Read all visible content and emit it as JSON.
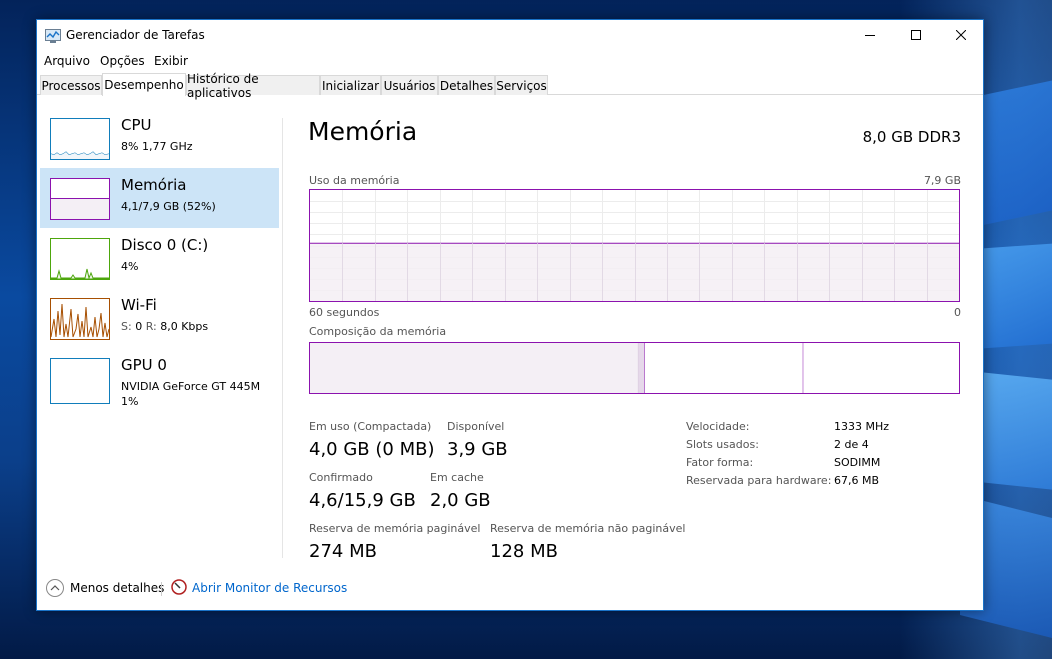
{
  "window": {
    "title": "Gerenciador de Tarefas"
  },
  "menu": [
    "Arquivo",
    "Opções",
    "Exibir"
  ],
  "tabs": [
    "Processos",
    "Desempenho",
    "Histórico de aplicativos",
    "Inicializar",
    "Usuários",
    "Detalhes",
    "Serviços"
  ],
  "active_tab": "Desempenho",
  "sidebar": {
    "items": [
      {
        "title": "CPU",
        "sub1": "8%  1,77 GHz",
        "sub2": "",
        "color": "#117dbb"
      },
      {
        "title": "Memória",
        "sub1": "4,1/7,9 GB (52%)",
        "sub2": "",
        "color": "#8b12ae"
      },
      {
        "title": "Disco 0 (C:)",
        "sub1": "4%",
        "sub2": "",
        "color": "#4da60c"
      },
      {
        "title": "Wi-Fi",
        "sub1_label_s": "S:",
        "sub1_s": "0",
        "sub1_label_r": "R:",
        "sub1_r": "8,0 Kbps",
        "color": "#a74f01"
      },
      {
        "title": "GPU 0",
        "sub1": "NVIDIA GeForce GT 445M",
        "sub2": "1%",
        "color": "#117dbb"
      }
    ],
    "active": "Memória"
  },
  "main": {
    "title": "Memória",
    "spec": "8,0 GB DDR3",
    "usage_label": "Uso da memória",
    "usage_max": "7,9 GB",
    "time_left": "60 segundos",
    "time_right": "0",
    "composition_label": "Composição da memória",
    "stats": {
      "in_use_label": "Em uso (Compactada)",
      "in_use_value": "4,0 GB (0 MB)",
      "available_label": "Disponível",
      "available_value": "3,9 GB",
      "committed_label": "Confirmado",
      "committed_value": "4,6/15,9 GB",
      "cached_label": "Em cache",
      "cached_value": "2,0 GB",
      "paged_label": "Reserva de memória paginável",
      "paged_value": "274 MB",
      "nonpaged_label": "Reserva de memória não paginável",
      "nonpaged_value": "128 MB"
    },
    "details": [
      {
        "key": "Velocidade:",
        "value": "1333 MHz"
      },
      {
        "key": "Slots usados:",
        "value": "2 de 4"
      },
      {
        "key": "Fator forma:",
        "value": "SODIMM"
      },
      {
        "key": "Reservada para hardware:",
        "value": "67,6 MB"
      }
    ]
  },
  "chart_data": {
    "type": "area",
    "title": "Uso da memória",
    "series": [
      {
        "values": [
          52,
          52,
          52,
          52,
          52,
          52,
          52,
          52,
          52,
          52,
          52,
          52,
          52,
          52,
          52,
          52,
          52,
          52,
          52,
          52,
          52
        ]
      }
    ],
    "ylim": [
      0,
      7.9
    ],
    "used_fraction": 0.52,
    "composition": {
      "in_use_fraction": 0.506,
      "modified_fraction": 0.01,
      "standby_fraction": 0.244,
      "free_fraction": 0.24
    }
  },
  "footer": {
    "fewer_details": "Menos detalhes",
    "resource_monitor": "Abrir Monitor de Recursos"
  },
  "colors": {
    "memory": "#8b12ae",
    "memory_fill": "#f4eff5",
    "accent": "#0066cc",
    "active_bg": "#cce4f7"
  }
}
